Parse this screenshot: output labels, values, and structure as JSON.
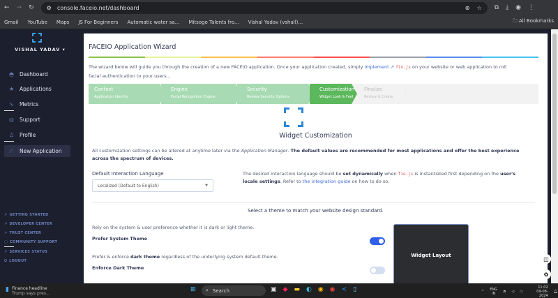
{
  "browser": {
    "url": "console.faceio.net/dashboard",
    "bookmarks": [
      "Gmail",
      "YouTube",
      "Maps",
      "JS For Beginners",
      "Automatic water sa...",
      "Mitsogo Talents fro...",
      "Vishal Yadav (vshall)..."
    ],
    "all_bookmarks": "All Bookmarks"
  },
  "sidebar": {
    "user": "VISHAL YADAV",
    "nav": [
      {
        "label": "Dashboard",
        "icon": "dashboard-icon"
      },
      {
        "label": "Applications",
        "icon": "star-icon"
      },
      {
        "label": "Metrics",
        "icon": "pulse-icon"
      },
      {
        "label": "Support",
        "icon": "headset-icon"
      },
      {
        "label": "Profile",
        "icon": "user-icon"
      },
      {
        "label": "New Application",
        "icon": "wand-icon"
      }
    ],
    "footer": [
      "GETTING STARTED",
      "DEVELOPER CENTER",
      "TRUST CENTER",
      "COMMUNITY SUPPORT",
      "SERVICES STATUS",
      "LOGOUT"
    ]
  },
  "wizard": {
    "title": "FACEIO Application Wizard",
    "color_bar": [
      "#8bc34a",
      "#e6f59a",
      "#ffc04d",
      "#ff7a6b",
      "#ff4d4d",
      "#9aa0a8",
      "#5b8def",
      "#45c2f0"
    ],
    "intro_a": "The wizard below will guide you through the creation of a new FACEIO application. Once your application created, simply ",
    "intro_link": "implement",
    "intro_code": "fio.js",
    "intro_b": " on your website or web application to roll facial authentication to your users...",
    "steps": [
      {
        "title": "Context",
        "sub": "Application Identity"
      },
      {
        "title": "Engine",
        "sub": "Facial Recognition Engine"
      },
      {
        "title": "Security",
        "sub": "Review Security Options"
      },
      {
        "title": "Customization",
        "sub": "Widget Look & Feel"
      },
      {
        "title": "Finalize",
        "sub": "Review & Create"
      }
    ],
    "section_title": "Widget Customization",
    "desc_a": "All customization settings can be altered at anytime later via the ",
    "desc_em": "Application Manager",
    "desc_b": ". ",
    "desc_bold": "The default values are recommended for most applications and offer the best experience across the spectrum of devices.",
    "lang_label": "Default Interaction Language",
    "lang_value": "Localized (Default to English)",
    "help_a": "The desired interaction language should be ",
    "help_b1": "set dynamically",
    "help_c": " when ",
    "help_code": "fio.js",
    "help_d": " is instantiated first depending on the ",
    "help_b2": "user's locale settings",
    "help_e": ". Refer to ",
    "help_link": "the integration guide",
    "help_f": " on how to do so.",
    "theme_prompt": "Select a theme to match your website design standard.",
    "opt1_desc": "Rely on the system & user preference whether it is dark or light theme.",
    "opt1_label": "Prefer System Theme",
    "opt1_on": true,
    "opt2_desc_a": "Prefer & enforce ",
    "opt2_desc_b": "dark theme",
    "opt2_desc_c": " regardless of the underlying system default theme.",
    "opt2_label": "Enforce Dark Theme",
    "opt2_on": false,
    "preview": "Widget Layout"
  },
  "taskbar": {
    "news_title": "Finance headline",
    "news_sub": "Trump says pres...",
    "search": "Search",
    "lang": "ENG",
    "region": "IN",
    "time": "11:02",
    "date": "09-08-2024"
  }
}
